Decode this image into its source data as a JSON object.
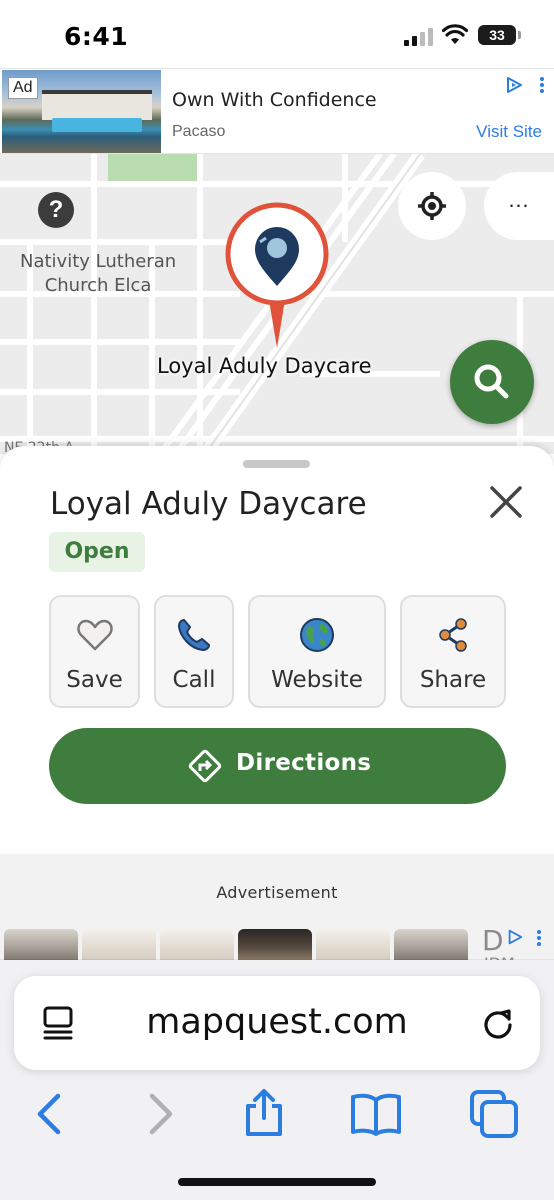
{
  "status_bar": {
    "time": "6:41",
    "battery": "33"
  },
  "top_ad": {
    "badge": "Ad",
    "title": "Own With Confidence",
    "advertiser": "Pacaso",
    "cta": "Visit Site"
  },
  "map": {
    "church_label_line1": "Nativity Lutheran",
    "church_label_line2": "Church Elca",
    "pin_label": "Loyal Aduly Daycare",
    "street_fragment": "NE 22th A",
    "help_symbol": "?",
    "more_symbol": "…"
  },
  "place": {
    "name": "Loyal Aduly Daycare",
    "status": "Open",
    "actions": [
      {
        "label": "Save",
        "icon": "heart-icon"
      },
      {
        "label": "Call",
        "icon": "phone-icon"
      },
      {
        "label": "Website",
        "icon": "globe-icon"
      },
      {
        "label": "Share",
        "icon": "share-icon"
      }
    ],
    "directions_label": "Directions"
  },
  "advertisement": {
    "label": "Advertisement",
    "brand_fragment": "D",
    "brand_fragment_2": "JDM"
  },
  "browser": {
    "url": "mapquest.com"
  },
  "colors": {
    "brand_green": "#3f7d3f",
    "pin_red": "#e0533a",
    "pin_navy": "#1f3a5f",
    "link_blue": "#2b7de1"
  }
}
